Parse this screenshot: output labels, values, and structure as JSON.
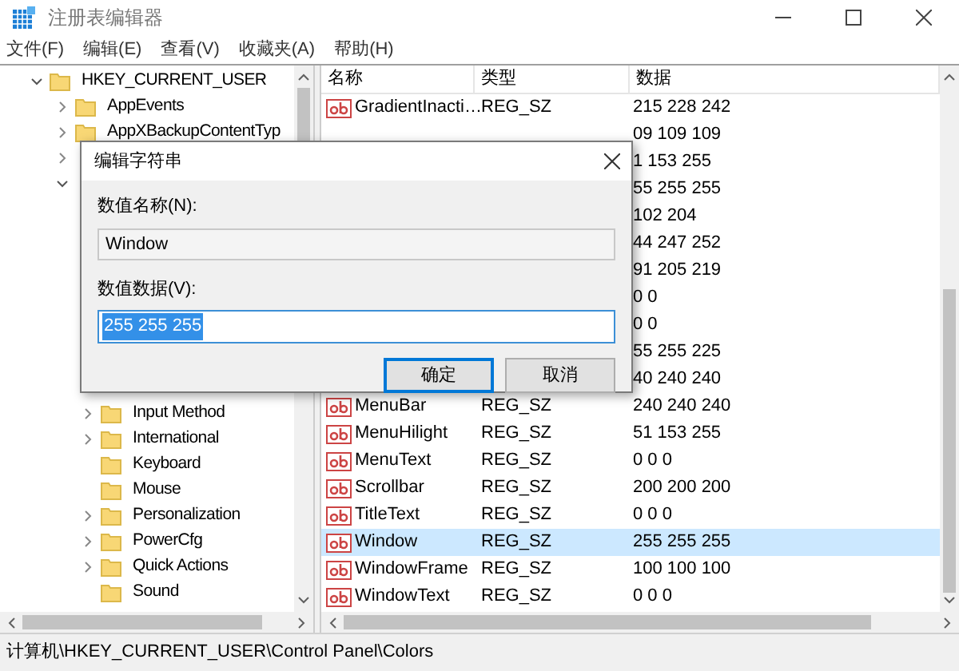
{
  "window": {
    "title": "注册表编辑器"
  },
  "menu": [
    "文件(F)",
    "编辑(E)",
    "查看(V)",
    "收藏夹(A)",
    "帮助(H)"
  ],
  "tree": {
    "label": "HKEY_CURRENT_USER",
    "expanded": true,
    "children": [
      {
        "label": "AppEvents",
        "expanded": false
      },
      {
        "label": "AppXBackupContentTyp",
        "expanded": false
      },
      {
        "expanded": false
      },
      {
        "expanded": true,
        "children": [
          {
            "label": "Input Method",
            "expanded": false
          },
          {
            "label": "International",
            "expanded": false
          },
          {
            "label": "Keyboard"
          },
          {
            "label": "Mouse"
          },
          {
            "label": "Personalization",
            "expanded": false
          },
          {
            "label": "PowerCfg",
            "expanded": false
          },
          {
            "label": "Quick Actions",
            "expanded": false
          },
          {
            "label": "Sound"
          }
        ]
      }
    ]
  },
  "list": {
    "columns": [
      "名称",
      "类型",
      "数据"
    ],
    "rows": [
      {
        "name": "GradientInacti…",
        "type": "REG_SZ",
        "data": "215 228 242",
        "selected": false
      },
      {
        "data": "09 109 109",
        "selected": false
      },
      {
        "data": "1 153 255",
        "selected": false
      },
      {
        "data": "55 255 255",
        "selected": false
      },
      {
        "data": "102 204",
        "selected": false
      },
      {
        "data": "44 247 252",
        "selected": false
      },
      {
        "data": "91 205 219",
        "selected": false
      },
      {
        "data": "0 0",
        "selected": false
      },
      {
        "data": "0 0",
        "selected": false
      },
      {
        "data": "55 255 225",
        "selected": false
      },
      {
        "data": "40 240 240",
        "selected": false
      },
      {
        "name": "MenuBar",
        "type": "REG_SZ",
        "data": "240 240 240",
        "selected": false
      },
      {
        "name": "MenuHilight",
        "type": "REG_SZ",
        "data": "51 153 255",
        "selected": false
      },
      {
        "name": "MenuText",
        "type": "REG_SZ",
        "data": "0 0 0",
        "selected": false
      },
      {
        "name": "Scrollbar",
        "type": "REG_SZ",
        "data": "200 200 200",
        "selected": false
      },
      {
        "name": "TitleText",
        "type": "REG_SZ",
        "data": "0 0 0",
        "selected": false
      },
      {
        "name": "Window",
        "type": "REG_SZ",
        "data": "255 255 255",
        "selected": true
      },
      {
        "name": "WindowFrame",
        "type": "REG_SZ",
        "data": "100 100 100",
        "selected": false
      },
      {
        "name": "WindowText",
        "type": "REG_SZ",
        "data": "0 0 0",
        "selected": false
      }
    ]
  },
  "dialog": {
    "title": "编辑字符串",
    "name_label": "数值名称(N):",
    "name_value": "Window",
    "data_label": "数值数据(V):",
    "data_value": "255 255 255",
    "buttons": [
      {
        "label": "确定",
        "default": true
      },
      {
        "label": "取消",
        "default": false
      }
    ]
  },
  "status_bar": "计算机\\HKEY_CURRENT_USER\\Control Panel\\Colors"
}
